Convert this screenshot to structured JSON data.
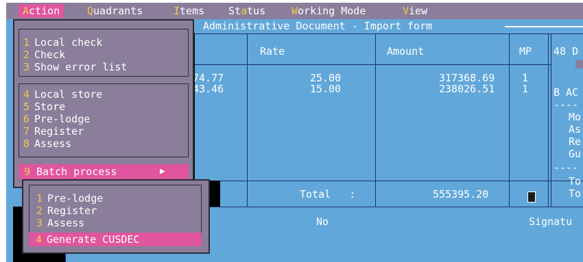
{
  "menubar": {
    "items": [
      {
        "hot": "A",
        "rest": "ction"
      },
      {
        "hot": "Q",
        "rest": "uadrants"
      },
      {
        "hot": "I",
        "rest": "tems"
      },
      {
        "pre": "St",
        "hot": "a",
        "rest": "tus"
      },
      {
        "hot": "W",
        "rest": "orking Mode"
      },
      {
        "hot": "V",
        "rest": "iew"
      }
    ]
  },
  "window": {
    "title": "Administrative Document - Import form"
  },
  "table": {
    "headers": {
      "rate": "Rate",
      "amount": "Amount",
      "mp": "MP",
      "box48": "48 D"
    },
    "rows": [
      {
        "partial": "74.77",
        "rate": "25.00",
        "amount": "317368.69",
        "mp": "1"
      },
      {
        "partial": "43.46",
        "rate": "15.00",
        "amount": "238026.51",
        "mp": "1"
      }
    ],
    "total_label": "Total   :",
    "total_value": "555395.20",
    "right_col": {
      "b_label": "B AC",
      "dash1": "----",
      "lines": [
        "Mo",
        "As",
        "Re",
        "Gu"
      ],
      "dash2": "----",
      "tot1": "To",
      "tot2": "To"
    },
    "footer_no": "No",
    "footer_sign": "Signatu"
  },
  "action_menu": {
    "group1": [
      {
        "num": "1",
        "label": "Local check"
      },
      {
        "num": "2",
        "label": "Check"
      },
      {
        "num": "3",
        "label": "Show error list"
      }
    ],
    "group2": [
      {
        "num": "4",
        "label": "Local store"
      },
      {
        "num": "5",
        "label": "Store"
      },
      {
        "num": "6",
        "label": "Pre-lodge"
      },
      {
        "num": "7",
        "label": "Register"
      },
      {
        "num": "8",
        "label": "Assess"
      }
    ],
    "batch": {
      "num": "9",
      "label": "Batch process",
      "arrow": "▶"
    }
  },
  "submenu": {
    "items": [
      {
        "num": "1",
        "label": "Pre-lodge"
      },
      {
        "num": "2",
        "label": "Register"
      },
      {
        "num": "3",
        "label": "Assess"
      },
      {
        "num": "4",
        "label": "Generate CUSDEC"
      }
    ]
  },
  "colors": {
    "screen_bg": "#62a7d9",
    "menu_bg": "#8a7e9a",
    "highlight": "#e0559d",
    "hotkey": "#f1c84a",
    "text": "#ffffff"
  }
}
